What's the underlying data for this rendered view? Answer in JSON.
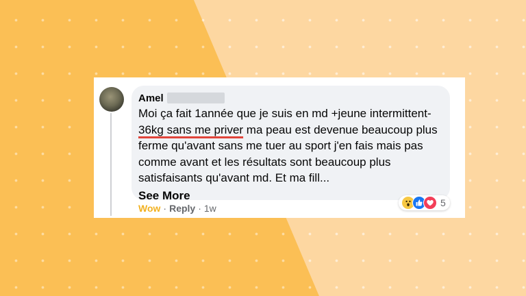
{
  "comment": {
    "author": "Amel",
    "text_before": "Moi ça fait 1année que je suis en md +jeune intermittent-",
    "highlight": "36kg sans me priver",
    "text_after": " ma peau est devenue beaucoup plus ferme qu'avant sans me tuer au sport j'en fais mais pas comme avant et les résultats sont beaucoup plus satisfaisants qu'avant md. Et ma fill...",
    "see_more": "See More"
  },
  "actions": {
    "wow": "Wow",
    "separator": "·",
    "reply": "Reply",
    "time": "1w"
  },
  "reactions": {
    "icons": [
      "wow-icon",
      "like-icon",
      "love-icon"
    ],
    "count": "5"
  },
  "colors": {
    "accent_underline": "#e0443a",
    "wow_text": "#f2b120",
    "bubble": "#f0f2f5",
    "background_left": "#fbbf55",
    "background_right": "#fdd7a1"
  }
}
